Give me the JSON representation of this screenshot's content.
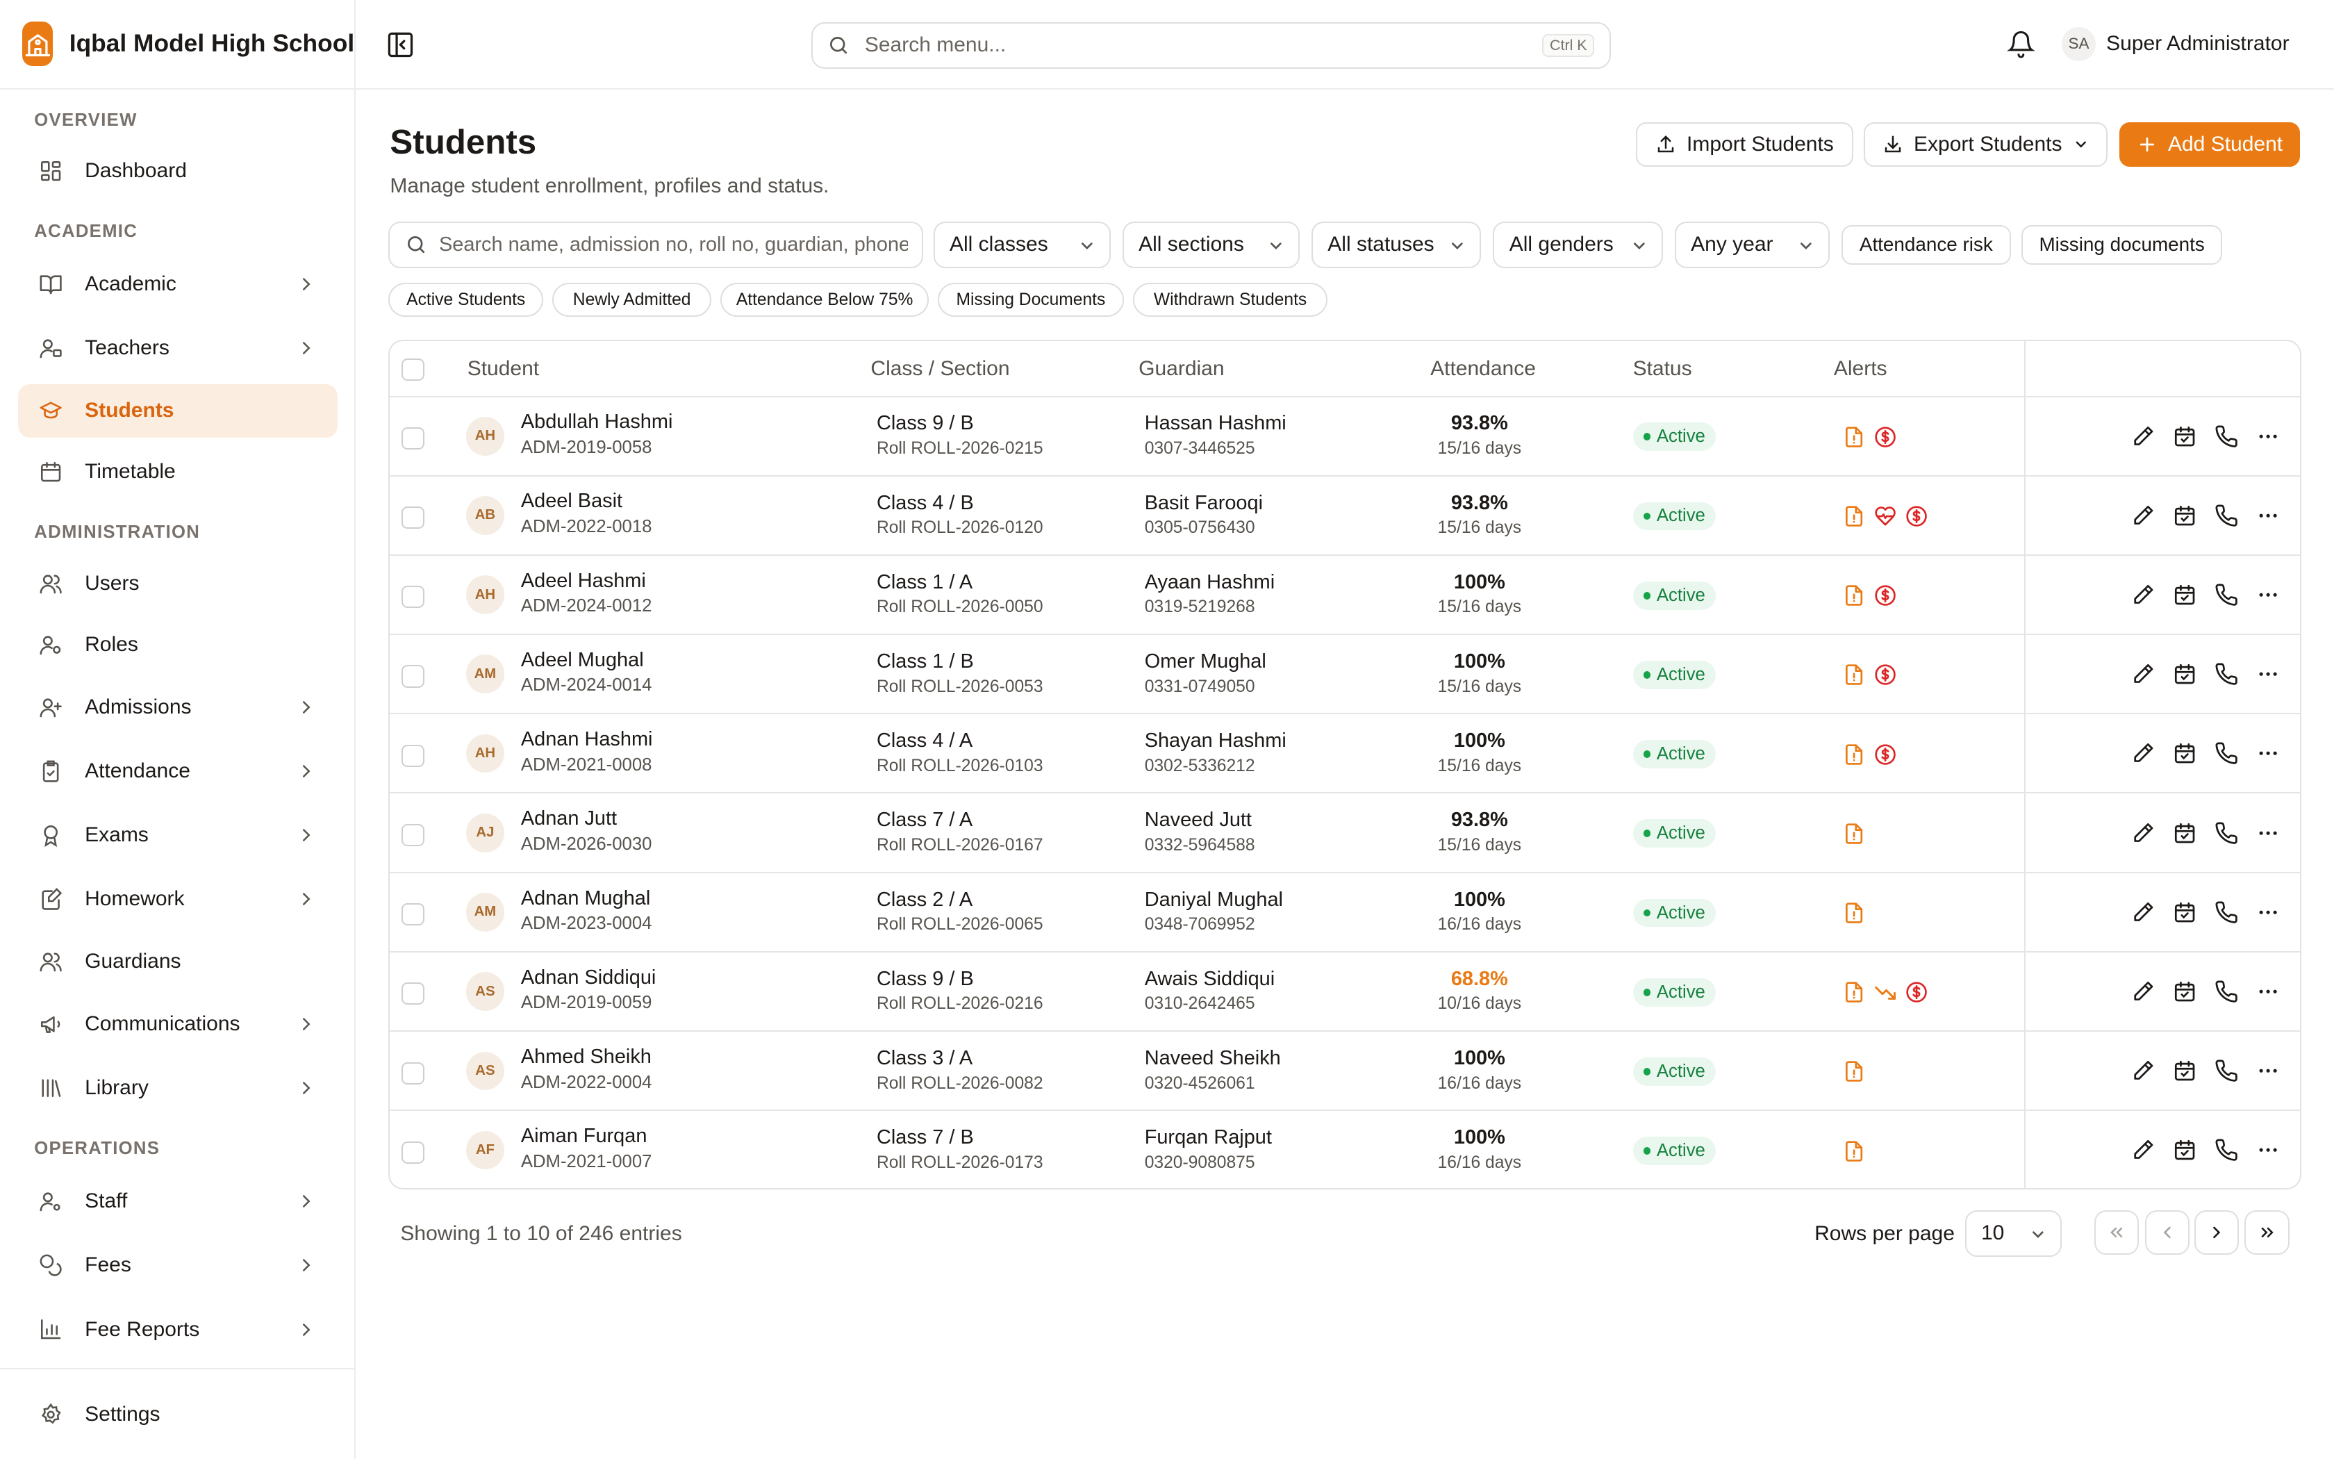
{
  "app": {
    "school_name": "Iqbal Model High School"
  },
  "topbar": {
    "search_placeholder": "Search menu...",
    "shortcut": "Ctrl K",
    "user_initials": "SA",
    "user_name": "Super Administrator"
  },
  "sidebar": {
    "sections": {
      "overview": "OVERVIEW",
      "academic": "ACADEMIC",
      "administration": "ADMINISTRATION",
      "operations": "OPERATIONS"
    },
    "items": {
      "dashboard": "Dashboard",
      "academic": "Academic",
      "teachers": "Teachers",
      "students": "Students",
      "timetable": "Timetable",
      "users": "Users",
      "roles": "Roles",
      "admissions": "Admissions",
      "attendance": "Attendance",
      "exams": "Exams",
      "homework": "Homework",
      "guardians": "Guardians",
      "communications": "Communications",
      "library": "Library",
      "staff": "Staff",
      "fees": "Fees",
      "fee_reports": "Fee Reports",
      "settings": "Settings"
    },
    "active": "students"
  },
  "page": {
    "title": "Students",
    "subtitle": "Manage student enrollment, profiles and status.",
    "import_label": "Import Students",
    "export_label": "Export Students",
    "add_label": "Add Student"
  },
  "filters": {
    "search_placeholder": "Search name, admission no, roll no, guardian, phone",
    "classes": "All classes",
    "sections": "All sections",
    "statuses": "All statuses",
    "genders": "All genders",
    "year": "Any year",
    "attendance_risk": "Attendance risk",
    "missing_documents": "Missing documents",
    "quick": [
      "Active Students",
      "Newly Admitted",
      "Attendance Below 75%",
      "Missing Documents",
      "Withdrawn Students"
    ]
  },
  "table": {
    "columns": {
      "student": "Student",
      "class_section": "Class / Section",
      "guardian": "Guardian",
      "attendance": "Attendance",
      "status": "Status",
      "alerts": "Alerts"
    },
    "rows": [
      {
        "initials": "AH",
        "name": "Abdullah Hashmi",
        "admission": "ADM-2019-0058",
        "class": "Class 9 / B",
        "roll": "Roll ROLL-2026-0215",
        "guardian": "Hassan Hashmi",
        "phone": "0307-3446525",
        "attendance": "93.8%",
        "days": "15/16 days",
        "status": "Active",
        "alerts": [
          "document-alert-icon",
          "fee-due-icon"
        ]
      },
      {
        "initials": "AB",
        "name": "Adeel Basit",
        "admission": "ADM-2022-0018",
        "class": "Class 4 / B",
        "roll": "Roll ROLL-2026-0120",
        "guardian": "Basit Farooqi",
        "phone": "0305-0756430",
        "attendance": "93.8%",
        "days": "15/16 days",
        "status": "Active",
        "alerts": [
          "document-alert-icon",
          "medical-alert-icon",
          "fee-due-icon"
        ]
      },
      {
        "initials": "AH",
        "name": "Adeel Hashmi",
        "admission": "ADM-2024-0012",
        "class": "Class 1 / A",
        "roll": "Roll ROLL-2026-0050",
        "guardian": "Ayaan Hashmi",
        "phone": "0319-5219268",
        "attendance": "100%",
        "days": "15/16 days",
        "status": "Active",
        "alerts": [
          "document-alert-icon",
          "fee-due-icon"
        ]
      },
      {
        "initials": "AM",
        "name": "Adeel Mughal",
        "admission": "ADM-2024-0014",
        "class": "Class 1 / B",
        "roll": "Roll ROLL-2026-0053",
        "guardian": "Omer Mughal",
        "phone": "0331-0749050",
        "attendance": "100%",
        "days": "15/16 days",
        "status": "Active",
        "alerts": [
          "document-alert-icon",
          "fee-due-icon"
        ]
      },
      {
        "initials": "AH",
        "name": "Adnan Hashmi",
        "admission": "ADM-2021-0008",
        "class": "Class 4 / A",
        "roll": "Roll ROLL-2026-0103",
        "guardian": "Shayan Hashmi",
        "phone": "0302-5336212",
        "attendance": "100%",
        "days": "15/16 days",
        "status": "Active",
        "alerts": [
          "document-alert-icon",
          "fee-due-icon"
        ]
      },
      {
        "initials": "AJ",
        "name": "Adnan Jutt",
        "admission": "ADM-2026-0030",
        "class": "Class 7 / A",
        "roll": "Roll ROLL-2026-0167",
        "guardian": "Naveed Jutt",
        "phone": "0332-5964588",
        "attendance": "93.8%",
        "days": "15/16 days",
        "status": "Active",
        "alerts": [
          "document-alert-icon"
        ]
      },
      {
        "initials": "AM",
        "name": "Adnan Mughal",
        "admission": "ADM-2023-0004",
        "class": "Class 2 / A",
        "roll": "Roll ROLL-2026-0065",
        "guardian": "Daniyal Mughal",
        "phone": "0348-7069952",
        "attendance": "100%",
        "days": "16/16 days",
        "status": "Active",
        "alerts": [
          "document-alert-icon"
        ]
      },
      {
        "initials": "AS",
        "name": "Adnan Siddiqui",
        "admission": "ADM-2019-0059",
        "class": "Class 9 / B",
        "roll": "Roll ROLL-2026-0216",
        "guardian": "Awais Siddiqui",
        "phone": "0310-2642465",
        "attendance": "68.8%",
        "days": "10/16 days",
        "status": "Active",
        "low": true,
        "alerts": [
          "document-alert-icon",
          "attendance-trend-icon",
          "fee-due-icon"
        ]
      },
      {
        "initials": "AS",
        "name": "Ahmed Sheikh",
        "admission": "ADM-2022-0004",
        "class": "Class 3 / A",
        "roll": "Roll ROLL-2026-0082",
        "guardian": "Naveed Sheikh",
        "phone": "0320-4526061",
        "attendance": "100%",
        "days": "16/16 days",
        "status": "Active",
        "alerts": [
          "document-alert-icon"
        ]
      },
      {
        "initials": "AF",
        "name": "Aiman Furqan",
        "admission": "ADM-2021-0007",
        "class": "Class 7 / B",
        "roll": "Roll ROLL-2026-0173",
        "guardian": "Furqan Rajput",
        "phone": "0320-9080875",
        "attendance": "100%",
        "days": "16/16 days",
        "status": "Active",
        "alerts": [
          "document-alert-icon"
        ]
      }
    ]
  },
  "footer": {
    "showing": "Showing 1 to 10 of 246 entries",
    "rows_per_page_label": "Rows per page",
    "rows_per_page": "10"
  },
  "colors": {
    "accent": "#ea7a13",
    "active_bg": "#fbeee0",
    "status_green": "#15803d",
    "alert_red": "#dc2626"
  }
}
